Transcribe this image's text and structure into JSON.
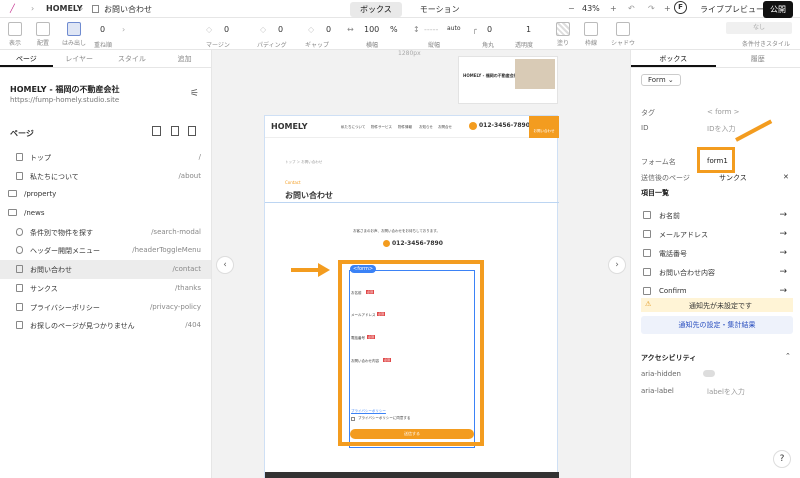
{
  "topbar": {
    "brand": "HOMELY",
    "page": "お問い合わせ",
    "tabs": [
      "ボックス",
      "モーション"
    ],
    "zoom": "43%",
    "live_preview": "ライブプレビュー",
    "publish": "公開"
  },
  "props": {
    "display": "表示",
    "layout": "配置",
    "overflow": "はみ出し",
    "overflow_val": "0",
    "children": "重ね順",
    "margin": "マージン",
    "margin_val": "0",
    "padding": "パディング",
    "padding_val": "0",
    "gap": "ギャップ",
    "gap_val": "0",
    "width": "横幅",
    "width_val": "100",
    "width_unit": "%",
    "height": "縦幅",
    "height_val": "auto",
    "radius": "角丸",
    "radius_val": "0",
    "opacity": "透明度",
    "opacity_val": "1",
    "fill": "塗り",
    "border": "枠線",
    "shadow": "シャドウ",
    "cond": "なし",
    "cond_label": "条件付きスタイル"
  },
  "left": {
    "tabs": [
      "ページ",
      "レイヤー",
      "スタイル",
      "追加"
    ],
    "site_name": "HOMELY - 福岡の不動産会社",
    "site_url": "https://fump-homely.studio.site",
    "pages_heading": "ページ",
    "pages": [
      {
        "name": "トップ",
        "path": "/"
      },
      {
        "name": "私たちについて",
        "path": "/about"
      },
      {
        "name": "/property",
        "path": ""
      },
      {
        "name": "/news",
        "path": ""
      },
      {
        "name": "条件別で物件を探す",
        "path": "/search-modal"
      },
      {
        "name": "ヘッダー開閉メニュー",
        "path": "/headerToggleMenu"
      },
      {
        "name": "お問い合わせ",
        "path": "/contact"
      },
      {
        "name": "サンクス",
        "path": "/thanks"
      },
      {
        "name": "プライバシーポリシー",
        "path": "/privacy-policy"
      },
      {
        "name": "お探しのページが見つかりません",
        "path": "/404"
      }
    ]
  },
  "canvas": {
    "width_label": "1280px",
    "logo": "HOMELY",
    "nav": [
      "私たちについて",
      "物件サービス",
      "物件情報",
      "お知らせ",
      "お問合せ"
    ],
    "phone": "012-3456-7890",
    "cta": "お問い合わせ",
    "breadcrumb": "トップ ＞ お問い合わせ",
    "section_en": "Contact",
    "title": "お問い合わせ",
    "intro": "お客さまのお声、お問い合わせをお待ちしております。",
    "form_tag": "<form>",
    "fields": [
      "お名前",
      "メールアドレス",
      "電話番号",
      "お問い合わせ内容"
    ],
    "required": "必須",
    "privacy_link": "プライバシーポリシー",
    "privacy_check": "プライバシーポリシーに同意する",
    "submit": "送信する"
  },
  "right": {
    "tabs": [
      "ボックス",
      "履歴"
    ],
    "element": "Form",
    "tag_label": "タグ",
    "tag_val": "< form >",
    "id_label": "ID",
    "id_ph": "IDを入力",
    "form_name_label": "フォーム名",
    "form_name_val": "form1",
    "after_label": "送信後のページ",
    "after_val": "サンクス",
    "items_heading": "項目一覧",
    "items": [
      "お名前",
      "メールアドレス",
      "電話番号",
      "お問い合わせ内容",
      "Confirm"
    ],
    "notice": "通知先が未設定です",
    "notice_btn": "通知先の設定・集計結果",
    "a11y": "アクセシビリティ",
    "aria_hidden": "aria-hidden",
    "aria_label": "aria-label",
    "aria_label_ph": "labelを入力",
    "help": "?"
  },
  "colors": {
    "accent": "#f39c1f",
    "selection": "#3b82f6",
    "warning": "#fff4d6"
  }
}
